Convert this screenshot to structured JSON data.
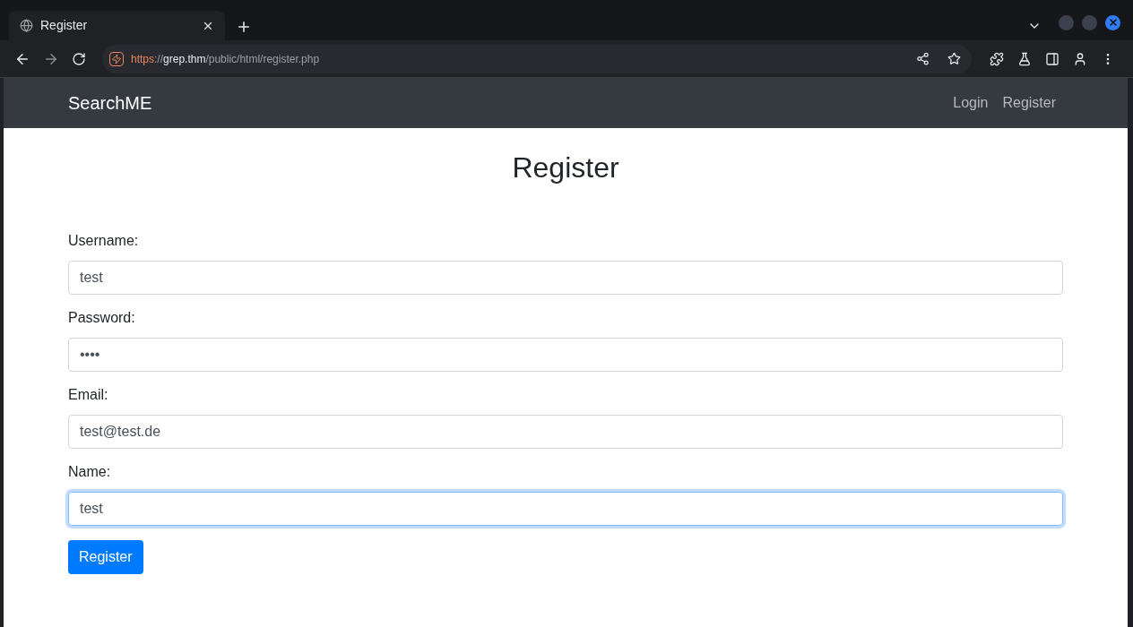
{
  "browser": {
    "tab": {
      "title": "Register"
    },
    "address": [
      {
        "kind": "scheme",
        "text": "https"
      },
      {
        "kind": "sep",
        "text": "://"
      },
      {
        "kind": "host",
        "text": "grep.thm"
      },
      {
        "kind": "path",
        "text": "/public/html/register.php"
      }
    ]
  },
  "navbar": {
    "brand": "SearchME",
    "links": [
      "Login",
      "Register"
    ]
  },
  "page": {
    "heading": "Register",
    "fields": [
      {
        "label": "Username:",
        "value": "test",
        "focused": false
      },
      {
        "label": "Password:",
        "value": "••••",
        "focused": false
      },
      {
        "label": "Email:",
        "value": "test@test.de",
        "focused": false
      },
      {
        "label": "Name:",
        "value": "test",
        "focused": true
      }
    ],
    "submit": "Register"
  }
}
